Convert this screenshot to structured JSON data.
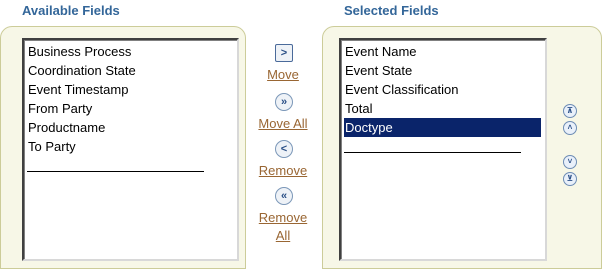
{
  "available": {
    "heading": "Available Fields",
    "items": [
      "Business Process",
      "Coordination State",
      "Event Timestamp",
      "From Party",
      "Productname",
      "To Party"
    ]
  },
  "selected": {
    "heading": "Selected Fields",
    "items": [
      "Event Name",
      "Event State",
      "Event Classification",
      "Total",
      "Doctype"
    ],
    "selected_item": "Doctype"
  },
  "shuttle": {
    "move": "Move",
    "move_all": "Move All",
    "remove": "Remove",
    "remove_all_line1": "Remove",
    "remove_all_line2": "All"
  },
  "icons": {
    "move": "chevron-right-icon",
    "move_all": "double-chevron-right-icon",
    "remove": "chevron-left-icon",
    "remove_all": "double-chevron-left-icon",
    "move_top": "move-to-top-icon",
    "move_up": "move-up-icon",
    "move_down": "move-down-icon",
    "move_bottom": "move-to-bottom-icon"
  },
  "colors": {
    "heading": "#336699",
    "link": "#996633",
    "selection": "#0a246a",
    "panel": "#f7f7e7"
  }
}
